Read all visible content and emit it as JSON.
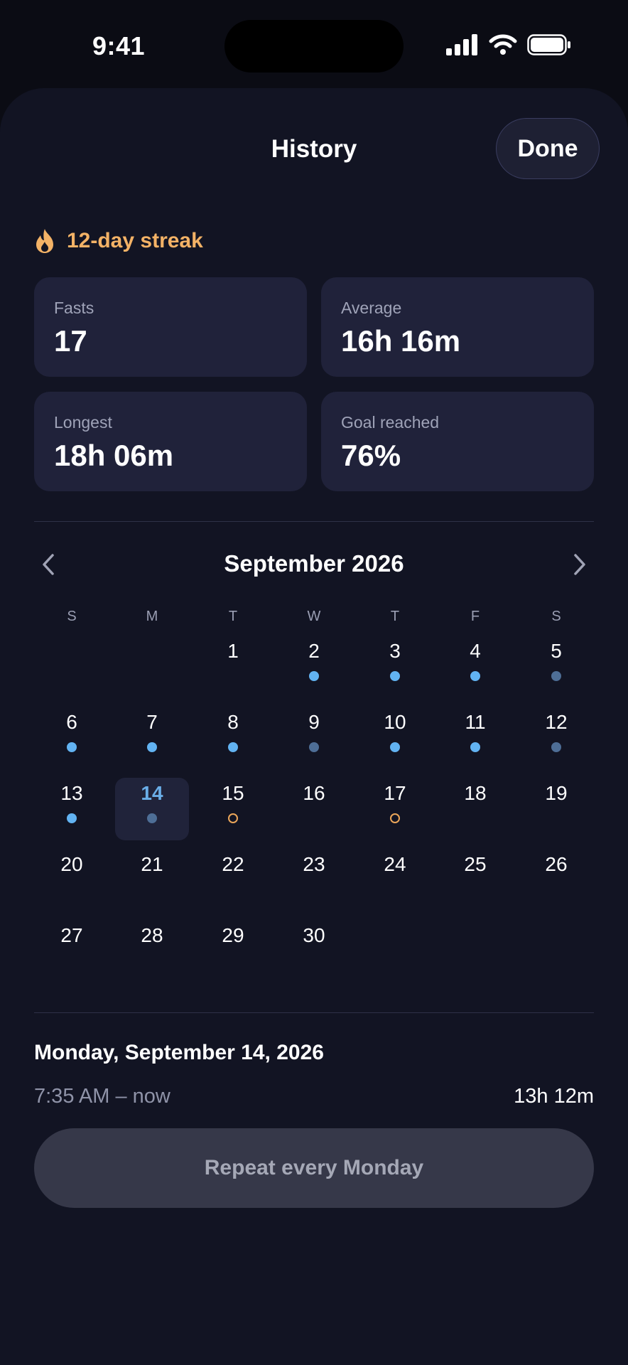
{
  "status_bar": {
    "time": "9:41"
  },
  "header": {
    "title": "History",
    "done_label": "Done"
  },
  "streak": {
    "label": "12-day streak"
  },
  "stats": [
    {
      "label": "Fasts",
      "value": "17"
    },
    {
      "label": "Average",
      "value": "16h 16m"
    },
    {
      "label": "Longest",
      "value": "18h 06m"
    },
    {
      "label": "Goal reached",
      "value": "76%"
    }
  ],
  "calendar": {
    "month_title": "September 2026",
    "weekdays": [
      "S",
      "M",
      "T",
      "W",
      "T",
      "F",
      "S"
    ],
    "first_weekday_index": 2,
    "days_in_month": 30,
    "selected_day": 14,
    "bright_dot_days": [
      2,
      3,
      4,
      6,
      7,
      8,
      10,
      11,
      13
    ],
    "dim_dot_days": [
      5,
      9,
      12,
      14
    ],
    "ring_dot_days": [
      15,
      17
    ]
  },
  "detail": {
    "date": "Monday, September 14, 2026",
    "range": "7:35 AM – now",
    "duration": "13h 12m",
    "repeat_label": "Repeat every Monday"
  },
  "colors": {
    "background": "#121423",
    "card": "#20223a",
    "accent_streak": "#f3b266",
    "dot_bright": "#62b3f2",
    "dot_dim": "#4e6e96",
    "dot_ring": "#eba65a"
  }
}
